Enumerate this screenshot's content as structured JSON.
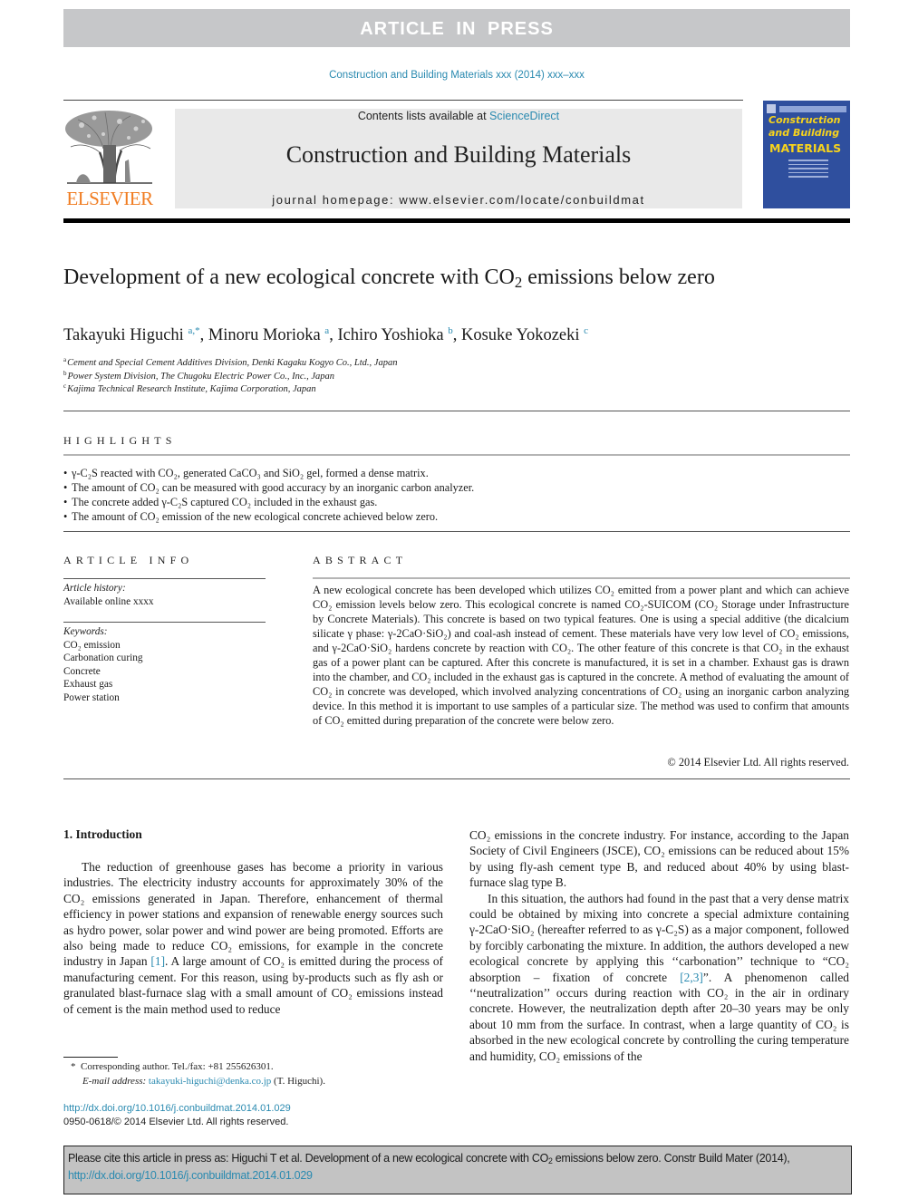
{
  "banner": "ARTICLE IN PRESS",
  "journal_ref": "Construction and Building Materials xxx (2014) xxx–xxx",
  "header": {
    "publisher_logo": "ELSEVIER",
    "contents_prefix": "Contents lists available at ",
    "contents_link": "ScienceDirect",
    "journal_title": "Construction and Building Materials",
    "homepage": "journal homepage: www.elsevier.com/locate/conbuildmat",
    "cover": {
      "line1": "Construction",
      "line2": "and Building",
      "line3": "MATERIALS",
      "bg_color": "#2f4f9e",
      "text_color": "#f7d31c"
    }
  },
  "article": {
    "title_part1": "Development of a new ecological concrete with CO",
    "title_sub": "2",
    "title_part2": " emissions below zero",
    "authors": [
      {
        "name": "Takayuki Higuchi",
        "sup": "a,*",
        "sep": ", "
      },
      {
        "name": "Minoru Morioka",
        "sup": "a",
        "sep": ", "
      },
      {
        "name": "Ichiro Yoshioka",
        "sup": "b",
        "sep": ", "
      },
      {
        "name": "Kosuke Yokozeki",
        "sup": "c",
        "sep": ""
      }
    ],
    "affiliations": [
      {
        "key": "a",
        "text": "Cement and Special Cement Additives Division, Denki Kagaku Kogyo Co., Ltd., Japan"
      },
      {
        "key": "b",
        "text": "Power System Division, The Chugoku Electric Power Co., Inc., Japan"
      },
      {
        "key": "c",
        "text": "Kajima Technical Research Institute, Kajima Corporation, Japan"
      }
    ]
  },
  "highlights": {
    "heading": "HIGHLIGHTS",
    "items": [
      "γ-C₂S reacted with CO₂, generated CaCO₃ and SiO₂ gel, formed a dense matrix.",
      "The amount of CO₂ can be measured with good accuracy by an inorganic carbon analyzer.",
      "The concrete added γ-C₂S captured CO₂ included in the exhaust gas.",
      "The amount of CO₂ emission of the new ecological concrete achieved below zero."
    ]
  },
  "article_info": {
    "heading": "ARTICLE INFO",
    "history_label": "Article history:",
    "history_value": "Available online xxxx",
    "keywords_label": "Keywords:",
    "keywords": [
      "CO₂ emission",
      "Carbonation curing",
      "Concrete",
      "Exhaust gas",
      "Power station"
    ]
  },
  "abstract": {
    "heading": "ABSTRACT",
    "text": "A new ecological concrete has been developed which utilizes CO₂ emitted from a power plant and which can achieve CO₂ emission levels below zero. This ecological concrete is named CO₂-SUICOM (CO₂ Storage under Infrastructure by Concrete Materials). This concrete is based on two typical features. One is using a special additive (the dicalcium silicate γ phase: γ-2CaO·SiO₂) and coal-ash instead of cement. These materials have very low level of CO₂ emissions, and γ-2CaO·SiO₂ hardens concrete by reaction with CO₂. The other feature of this concrete is that CO₂ in the exhaust gas of a power plant can be captured. After this concrete is manufactured, it is set in a chamber. Exhaust gas is drawn into the chamber, and CO₂ included in the exhaust gas is captured in the concrete. A method of evaluating the amount of CO₂ in concrete was developed, which involved analyzing concentrations of CO₂ using an inorganic carbon analyzing device. In this method it is important to use samples of a particular size. The method was used to confirm that amounts of CO₂ emitted during preparation of the concrete were below zero.",
    "copyright": "© 2014 Elsevier Ltd. All rights reserved."
  },
  "introduction": {
    "heading": "1. Introduction",
    "left_p1_a": "The reduction of greenhouse gases has become a priority in various industries. The electricity industry accounts for approximately 30% of the CO₂ emissions generated in Japan. Therefore, enhancement of thermal efficiency in power stations and expansion of renewable energy sources such as hydro power, solar power and wind power are being promoted. Efforts are also being made to reduce CO₂ emissions, for example in the concrete industry in Japan ",
    "left_cite1": "[1]",
    "left_p1_b": ". A large amount of CO₂ is emitted during the process of manufacturing cement. For this reason, using by-products such as fly ash or granulated blast-furnace slag with a small amount of CO₂ emissions instead of cement is the main method used to reduce",
    "right_p1": "CO₂ emissions in the concrete industry. For instance, according to the Japan Society of Civil Engineers (JSCE), CO₂ emissions can be reduced about 15% by using fly-ash cement type B, and reduced about 40% by using blast-furnace slag type B.",
    "right_p2_a": "In this situation, the authors had found in the past that a very dense matrix could be obtained by mixing into concrete a special admixture containing γ-2CaO·SiO₂ (hereafter referred to as γ-C₂S) as a major component, followed by forcibly carbonating the mixture. In addition, the authors developed a new ecological concrete by applying this ‘‘carbonation’’ technique to “CO₂ absorption – fixation of concrete ",
    "right_cite23": "[2,3]",
    "right_p2_b": "”. A phenomenon called ‘‘neutralization’’ occurs during reaction with CO₂ in the air in ordinary concrete. However, the neutralization depth after 20–30 years may be only about 10 mm from the surface. In contrast, when a large quantity of CO₂ is absorbed in the new ecological concrete by controlling the curing temperature and humidity, CO₂ emissions of the"
  },
  "footnote": {
    "marker": "*",
    "corresponding": "Corresponding author. Tel./fax: +81 255626301.",
    "email_label": "E-mail address: ",
    "email": "takayuki-higuchi@denka.co.jp",
    "email_suffix": " (T. Higuchi)."
  },
  "doi": {
    "link": "http://dx.doi.org/10.1016/j.conbuildmat.2014.01.029",
    "issn_line": "0950-0618/© 2014 Elsevier Ltd. All rights reserved."
  },
  "cite_box": {
    "text_a": "Please cite this article in press as: Higuchi T et al. Development of a new ecological concrete with CO",
    "text_sub": "2",
    "text_b": " emissions below zero. Constr Build Mater (2014),",
    "link": "http://dx.doi.org/10.1016/j.conbuildmat.2014.01.029"
  },
  "colors": {
    "link": "#2a8ab0",
    "banner_bg": "#c6c7c9",
    "elsevier_orange": "#f07c21"
  }
}
